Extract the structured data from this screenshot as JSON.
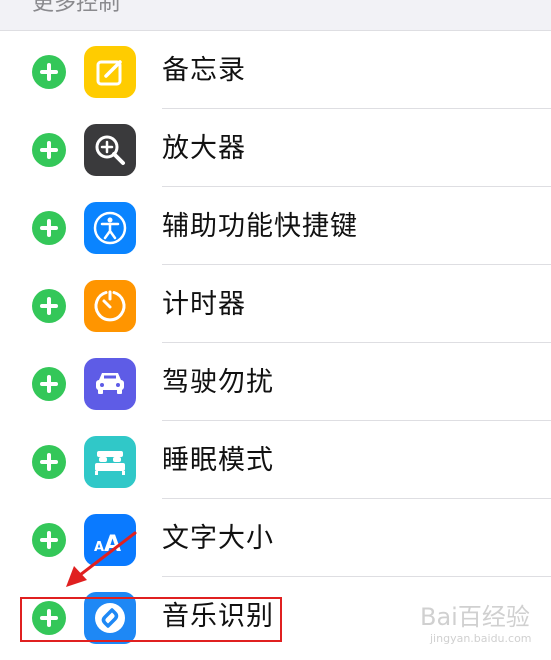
{
  "section": {
    "title": "更多控制"
  },
  "items": [
    {
      "label": "备忘录",
      "icon": "notes-icon",
      "color": "#ffcc00"
    },
    {
      "label": "放大器",
      "icon": "magnifier-icon",
      "color": "#3a3a3c"
    },
    {
      "label": "辅助功能快捷键",
      "icon": "accessibility-icon",
      "color": "#0a84ff"
    },
    {
      "label": "计时器",
      "icon": "timer-icon",
      "color": "#ff9500"
    },
    {
      "label": "驾驶勿扰",
      "icon": "car-icon",
      "color": "#5e5ce6"
    },
    {
      "label": "睡眠模式",
      "icon": "bed-icon",
      "color": "#30c8c8"
    },
    {
      "label": "文字大小",
      "icon": "text-size-icon",
      "color": "#0a7aff"
    },
    {
      "label": "音乐识别",
      "icon": "shazam-icon",
      "color": "#1e88f5"
    }
  ],
  "watermark": {
    "brand": "Bai百经验",
    "url": "jingyan.baidu.com"
  },
  "colors": {
    "add": "#34c759",
    "highlight": "#e02020"
  }
}
